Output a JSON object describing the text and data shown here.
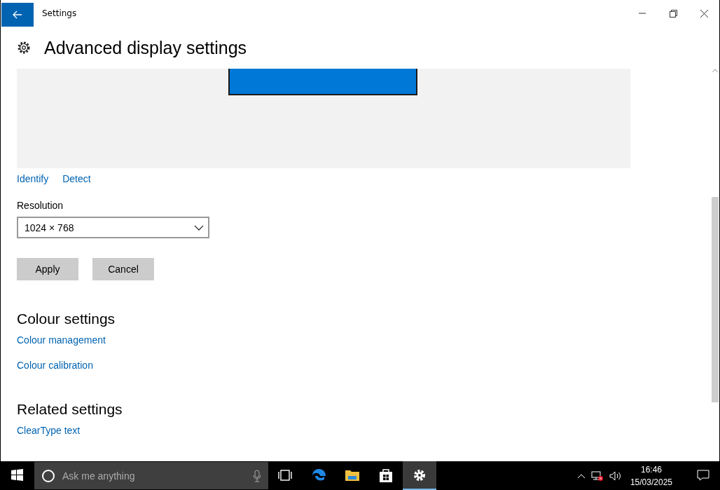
{
  "window": {
    "title": "Settings"
  },
  "page": {
    "title": "Advanced display settings"
  },
  "display_links": [
    "Identify",
    "Detect"
  ],
  "resolution": {
    "label": "Resolution",
    "value": "1024 × 768"
  },
  "buttons": [
    "Apply",
    "Cancel"
  ],
  "sections": [
    {
      "heading": "Colour settings",
      "links": [
        "Colour management",
        "Colour calibration"
      ]
    },
    {
      "heading": "Related settings",
      "links": [
        "ClearType text"
      ]
    }
  ],
  "taskbar": {
    "search": {
      "placeholder": "Ask me anything"
    },
    "apps": [
      {
        "kind": "taskview",
        "selected": false
      },
      {
        "kind": "edge",
        "selected": false
      },
      {
        "kind": "explorer",
        "selected": false
      },
      {
        "kind": "store",
        "selected": false
      },
      {
        "kind": "settings",
        "selected": true
      }
    ],
    "clock": {
      "time": "16:46",
      "date": "15/03/2025"
    }
  }
}
